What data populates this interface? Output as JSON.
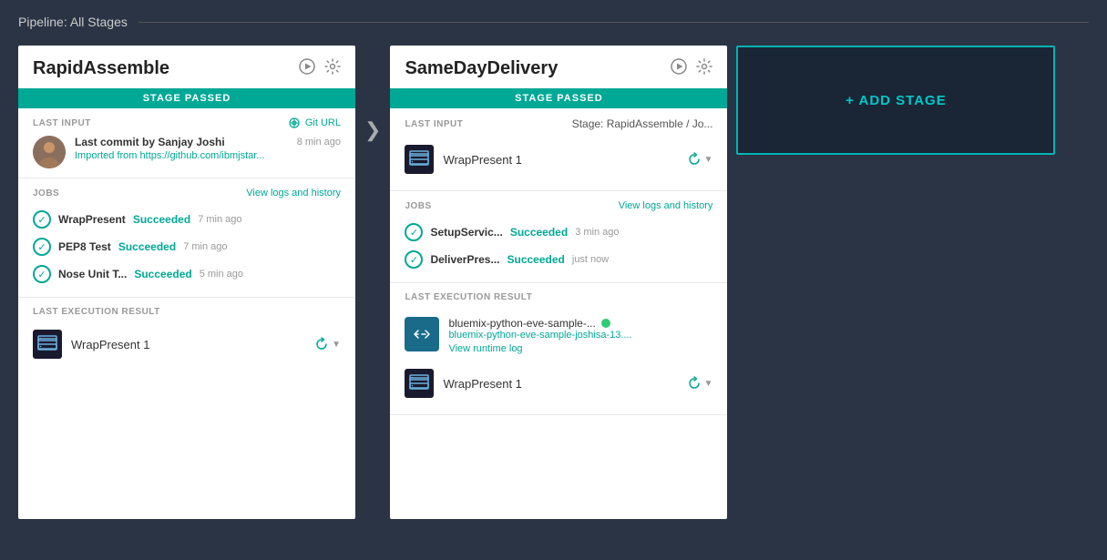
{
  "page": {
    "title": "Pipeline: All Stages"
  },
  "stages": [
    {
      "id": "rapid-assemble",
      "name": "RapidAssemble",
      "status": "STAGE PASSED",
      "last_input_label": "LAST INPUT",
      "git_url_label": "Git URL",
      "commit_author": "Last commit by Sanjay Joshi",
      "commit_time": "8 min ago",
      "commit_link": "Imported from https://github.com/ibmjstar...",
      "jobs_label": "JOBS",
      "view_logs_label": "View logs and history",
      "jobs": [
        {
          "name": "WrapPresent",
          "status": "Succeeded",
          "time": "7 min ago"
        },
        {
          "name": "PEP8 Test",
          "status": "Succeeded",
          "time": "7 min ago"
        },
        {
          "name": "Nose Unit T...",
          "status": "Succeeded",
          "time": "5 min ago"
        }
      ],
      "last_execution_label": "LAST EXECUTION RESULT",
      "execution_name": "WrapPresent 1"
    },
    {
      "id": "same-day-delivery",
      "name": "SameDayDelivery",
      "status": "STAGE PASSED",
      "last_input_label": "LAST INPUT",
      "last_input_value": "Stage: RapidAssemble  /  Jo...",
      "input_item_name": "WrapPresent 1",
      "jobs_label": "JOBS",
      "view_logs_label": "View logs and history",
      "jobs": [
        {
          "name": "SetupServic...",
          "status": "Succeeded",
          "time": "3 min ago"
        },
        {
          "name": "DeliverPres...",
          "status": "Succeeded",
          "time": "just now"
        }
      ],
      "last_execution_label": "LAST EXECUTION RESULT",
      "app_name": "bluemix-python-eve-sample-...",
      "app_link": "bluemix-python-eve-sample-joshisa-13....",
      "runtime_log_label": "View runtime log",
      "execution_name2": "WrapPresent 1"
    }
  ],
  "add_stage": {
    "label": "+ ADD STAGE"
  }
}
